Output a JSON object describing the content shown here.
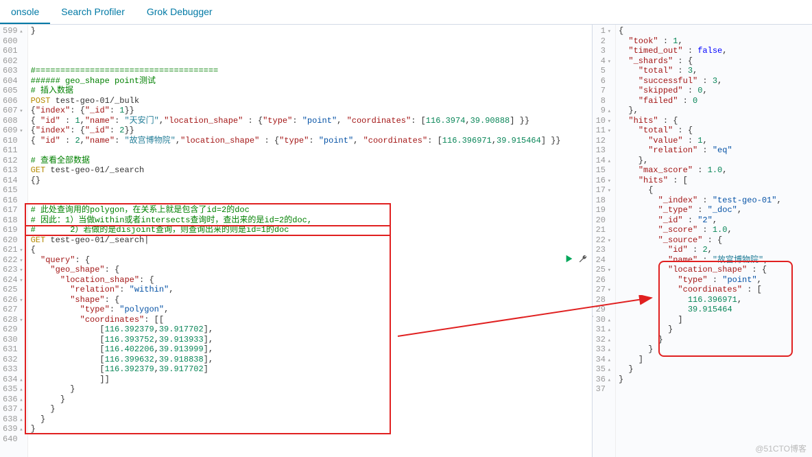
{
  "tabs": {
    "console": "onsole",
    "profiler": "Search Profiler",
    "grok": "Grok Debugger"
  },
  "watermark": "@51CTO博客",
  "left": {
    "start": 599,
    "lines": [
      {
        "n": 599,
        "f": "▴",
        "t": "}",
        "cls": ""
      },
      {
        "n": 600,
        "t": "",
        "cls": ""
      },
      {
        "n": 601,
        "t": "",
        "cls": ""
      },
      {
        "n": 602,
        "t": "",
        "cls": ""
      },
      {
        "n": 603,
        "t": "#=====================================",
        "cls": "c-comment"
      },
      {
        "n": 604,
        "t": "###### geo_shape point测试",
        "cls": "c-comment"
      },
      {
        "n": 605,
        "t": "# 插入数据",
        "cls": "c-comment"
      },
      {
        "n": 606,
        "html": "<span class='c-method'>POST</span> test-geo-01/_bulk"
      },
      {
        "n": 607,
        "f": "▾",
        "html": "{<span class='c-key'>\"index\"</span>: {<span class='c-key'>\"_id\"</span>: <span class='c-num'>1</span>}}"
      },
      {
        "n": 608,
        "html": "{ <span class='c-key'>\"id\"</span> : <span class='c-num'>1</span>,<span class='c-key'>\"name\"</span>: <span class='c-name'>\"天安门\"</span>,<span class='c-key'>\"location_shape\"</span> : {<span class='c-key'>\"type\"</span>: <span class='c-str'>\"point\"</span>, <span class='c-key'>\"coordinates\"</span>: [<span class='c-num'>116.3974</span>,<span class='c-num'>39.90888</span>] }}"
      },
      {
        "n": 609,
        "f": "▾",
        "html": "{<span class='c-key'>\"index\"</span>: {<span class='c-key'>\"_id\"</span>: <span class='c-num'>2</span>}}"
      },
      {
        "n": 610,
        "html": "{ <span class='c-key'>\"id\"</span> : <span class='c-num'>2</span>,<span class='c-key'>\"name\"</span>: <span class='c-name'>\"故宫博物院\"</span>,<span class='c-key'>\"location_shape\"</span> : {<span class='c-key'>\"type\"</span>: <span class='c-str'>\"point\"</span>, <span class='c-key'>\"coordinates\"</span>: [<span class='c-num'>116.396971</span>,<span class='c-num'>39.915464</span>] }}"
      },
      {
        "n": 611,
        "t": "",
        "cls": ""
      },
      {
        "n": 612,
        "t": "# 查看全部数据",
        "cls": "c-comment"
      },
      {
        "n": 613,
        "html": "<span class='c-method'>GET</span> test-geo-01/_search"
      },
      {
        "n": 614,
        "t": "{}",
        "cls": ""
      },
      {
        "n": 615,
        "t": "",
        "cls": ""
      },
      {
        "n": 616,
        "t": "",
        "cls": ""
      },
      {
        "n": 617,
        "t": "# 此处查询用的polygon，在关系上就是包含了id=2的doc",
        "cls": "c-comment"
      },
      {
        "n": 618,
        "t": "# 因此：1）当做within或者intersects查询时，查出来的是id=2的doc,",
        "cls": "c-comment"
      },
      {
        "n": 619,
        "t": "#       2）若做的是disjoint查询，则查询出来的则是id=1的doc",
        "cls": "c-comment"
      },
      {
        "n": 620,
        "html": "<span class='c-method'>GET</span> test-geo-01/_search|"
      },
      {
        "n": 621,
        "f": "▾",
        "t": "{",
        "cls": ""
      },
      {
        "n": 622,
        "f": "▾",
        "html": "  <span class='c-key'>\"query\"</span>: {"
      },
      {
        "n": 623,
        "f": "▾",
        "html": "    <span class='c-key'>\"geo_shape\"</span>: {"
      },
      {
        "n": 624,
        "f": "▾",
        "html": "      <span class='c-key'>\"location_shape\"</span>: {"
      },
      {
        "n": 625,
        "html": "        <span class='c-key'>\"relation\"</span>: <span class='c-str'>\"within\"</span>,"
      },
      {
        "n": 626,
        "f": "▾",
        "html": "        <span class='c-key'>\"shape\"</span>: {"
      },
      {
        "n": 627,
        "html": "          <span class='c-key'>\"type\"</span>: <span class='c-str'>\"polygon\"</span>,"
      },
      {
        "n": 628,
        "f": "▾",
        "html": "          <span class='c-key'>\"coordinates\"</span>: [["
      },
      {
        "n": 629,
        "html": "              [<span class='c-num'>116.392379</span>,<span class='c-num'>39.917702</span>],"
      },
      {
        "n": 630,
        "html": "              [<span class='c-num'>116.393752</span>,<span class='c-num'>39.913933</span>],"
      },
      {
        "n": 631,
        "html": "              [<span class='c-num'>116.402206</span>,<span class='c-num'>39.913999</span>],"
      },
      {
        "n": 632,
        "html": "              [<span class='c-num'>116.399632</span>,<span class='c-num'>39.918838</span>],"
      },
      {
        "n": 633,
        "html": "              [<span class='c-num'>116.392379</span>,<span class='c-num'>39.917702</span>]"
      },
      {
        "n": 634,
        "f": "▴",
        "t": "              ]]",
        "cls": ""
      },
      {
        "n": 635,
        "f": "▴",
        "t": "        }",
        "cls": ""
      },
      {
        "n": 636,
        "f": "▴",
        "t": "      }",
        "cls": ""
      },
      {
        "n": 637,
        "f": "▴",
        "t": "    }",
        "cls": ""
      },
      {
        "n": 638,
        "f": "▴",
        "t": "  }",
        "cls": ""
      },
      {
        "n": 639,
        "f": "▴",
        "t": "}",
        "cls": ""
      },
      {
        "n": 640,
        "t": "",
        "cls": ""
      }
    ]
  },
  "right": {
    "lines": [
      {
        "n": 1,
        "f": "▾",
        "t": "{",
        "cls": ""
      },
      {
        "n": 2,
        "html": "  <span class='c-key'>\"took\"</span> : <span class='c-num'>1</span>,"
      },
      {
        "n": 3,
        "html": "  <span class='c-key'>\"timed_out\"</span> : <span class='c-bool'>false</span>,"
      },
      {
        "n": 4,
        "f": "▾",
        "html": "  <span class='c-key'>\"_shards\"</span> : {"
      },
      {
        "n": 5,
        "html": "    <span class='c-key'>\"total\"</span> : <span class='c-num'>3</span>,"
      },
      {
        "n": 6,
        "html": "    <span class='c-key'>\"successful\"</span> : <span class='c-num'>3</span>,"
      },
      {
        "n": 7,
        "html": "    <span class='c-key'>\"skipped\"</span> : <span class='c-num'>0</span>,"
      },
      {
        "n": 8,
        "html": "    <span class='c-key'>\"failed\"</span> : <span class='c-num'>0</span>"
      },
      {
        "n": 9,
        "f": "▴",
        "t": "  },",
        "cls": ""
      },
      {
        "n": 10,
        "f": "▾",
        "html": "  <span class='c-key'>\"hits\"</span> : {"
      },
      {
        "n": 11,
        "f": "▾",
        "html": "    <span class='c-key'>\"total\"</span> : {"
      },
      {
        "n": 12,
        "html": "      <span class='c-key'>\"value\"</span> : <span class='c-num'>1</span>,"
      },
      {
        "n": 13,
        "html": "      <span class='c-key'>\"relation\"</span> : <span class='c-str'>\"eq\"</span>"
      },
      {
        "n": 14,
        "f": "▴",
        "t": "    },",
        "cls": ""
      },
      {
        "n": 15,
        "html": "    <span class='c-key'>\"max_score\"</span> : <span class='c-num'>1.0</span>,"
      },
      {
        "n": 16,
        "f": "▾",
        "html": "    <span class='c-key'>\"hits\"</span> : ["
      },
      {
        "n": 17,
        "f": "▾",
        "t": "      {",
        "cls": ""
      },
      {
        "n": 18,
        "html": "        <span class='c-key'>\"_index\"</span> : <span class='c-str'>\"test-geo-01\"</span>,"
      },
      {
        "n": 19,
        "html": "        <span class='c-key'>\"_type\"</span> : <span class='c-str'>\"_doc\"</span>,"
      },
      {
        "n": 20,
        "html": "        <span class='c-key'>\"_id\"</span> : <span class='c-str'>\"2\"</span>,"
      },
      {
        "n": 21,
        "html": "        <span class='c-key'>\"_score\"</span> : <span class='c-num'>1.0</span>,"
      },
      {
        "n": 22,
        "f": "▾",
        "html": "        <span class='c-key'>\"_source\"</span> : {"
      },
      {
        "n": 23,
        "html": "          <span class='c-key'>\"id\"</span> : <span class='c-num'>2</span>,"
      },
      {
        "n": 24,
        "html": "          <span class='c-key'>\"name\"</span> : <span class='c-name'>\"故宫博物院\"</span>,"
      },
      {
        "n": 25,
        "f": "▾",
        "html": "          <span class='c-key'>\"location_shape\"</span> : {"
      },
      {
        "n": 26,
        "html": "            <span class='c-key'>\"type\"</span> : <span class='c-str'>\"point\"</span>,"
      },
      {
        "n": 27,
        "f": "▾",
        "html": "            <span class='c-key'>\"coordinates\"</span> : ["
      },
      {
        "n": 28,
        "html": "              <span class='c-num'>116.396971</span>,"
      },
      {
        "n": 29,
        "html": "              <span class='c-num'>39.915464</span>"
      },
      {
        "n": 30,
        "f": "▴",
        "t": "            ]",
        "cls": ""
      },
      {
        "n": 31,
        "f": "▴",
        "t": "          }",
        "cls": ""
      },
      {
        "n": 32,
        "f": "▴",
        "t": "        }",
        "cls": ""
      },
      {
        "n": 33,
        "f": "▴",
        "t": "      }",
        "cls": ""
      },
      {
        "n": 34,
        "f": "▴",
        "t": "    ]",
        "cls": ""
      },
      {
        "n": 35,
        "f": "▴",
        "t": "  }",
        "cls": ""
      },
      {
        "n": 36,
        "f": "▴",
        "t": "}",
        "cls": ""
      },
      {
        "n": 37,
        "t": "",
        "cls": ""
      }
    ]
  }
}
